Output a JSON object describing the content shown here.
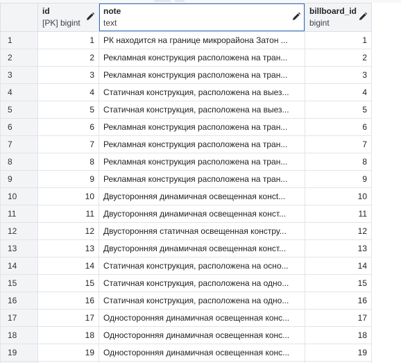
{
  "columns": [
    {
      "key": "index",
      "name": "",
      "type": ""
    },
    {
      "key": "id",
      "name": "id",
      "type": "[PK] bigint"
    },
    {
      "key": "note",
      "name": "note",
      "type": "text"
    },
    {
      "key": "billboard_id",
      "name": "billboard_id",
      "type": "bigint"
    }
  ],
  "rows": [
    {
      "index": "1",
      "id": "1",
      "note": "РК находится на границе микрорайона Затон ...",
      "billboard_id": "1"
    },
    {
      "index": "2",
      "id": "2",
      "note": "Рекламная конструкция расположена на тран...",
      "billboard_id": "2"
    },
    {
      "index": "3",
      "id": "3",
      "note": "Рекламная конструкция расположена на тран...",
      "billboard_id": "3"
    },
    {
      "index": "4",
      "id": "4",
      "note": "Статичная конструкция, расположена на выез...",
      "billboard_id": "4"
    },
    {
      "index": "5",
      "id": "5",
      "note": "Статичная конструкция, расположена на выез...",
      "billboard_id": "5"
    },
    {
      "index": "6",
      "id": "6",
      "note": "Рекламная конструкция расположена на тран...",
      "billboard_id": "6"
    },
    {
      "index": "7",
      "id": "7",
      "note": "Рекламная конструкция расположена на тран...",
      "billboard_id": "7"
    },
    {
      "index": "8",
      "id": "8",
      "note": "Рекламная конструкция расположена на тран...",
      "billboard_id": "8"
    },
    {
      "index": "9",
      "id": "9",
      "note": "Рекламная конструкция расположена на тран...",
      "billboard_id": "9"
    },
    {
      "index": "10",
      "id": "10",
      "note": "Двусторонняя динамичная освещенная консt...",
      "billboard_id": "10"
    },
    {
      "index": "11",
      "id": "11",
      "note": "Двусторонняя динамичная освещенная конст...",
      "billboard_id": "11"
    },
    {
      "index": "12",
      "id": "12",
      "note": "Двусторонняя статичная освещенная констру...",
      "billboard_id": "12"
    },
    {
      "index": "13",
      "id": "13",
      "note": "Двусторонняя динамичная освещенная конст...",
      "billboard_id": "13"
    },
    {
      "index": "14",
      "id": "14",
      "note": "Статичная конструкция, расположена на осно...",
      "billboard_id": "14"
    },
    {
      "index": "15",
      "id": "15",
      "note": "Статичная конструкция, расположена на одно...",
      "billboard_id": "15"
    },
    {
      "index": "16",
      "id": "16",
      "note": "Статичная конструкция, расположена на одно...",
      "billboard_id": "16"
    },
    {
      "index": "17",
      "id": "17",
      "note": "Односторонняя динамичная освещенная конс...",
      "billboard_id": "17"
    },
    {
      "index": "18",
      "id": "18",
      "note": "Односторонняя динамичная освещенная конс...",
      "billboard_id": "18"
    },
    {
      "index": "19",
      "id": "19",
      "note": "Односторонняя динамичная освещенная конс...",
      "billboard_id": "19"
    }
  ],
  "icons": {
    "edit": "pencil-icon"
  },
  "colors": {
    "header_bg": "#f3f4f6",
    "selected_border": "#2f6fc0",
    "grid_line": "#e1e4e8"
  }
}
